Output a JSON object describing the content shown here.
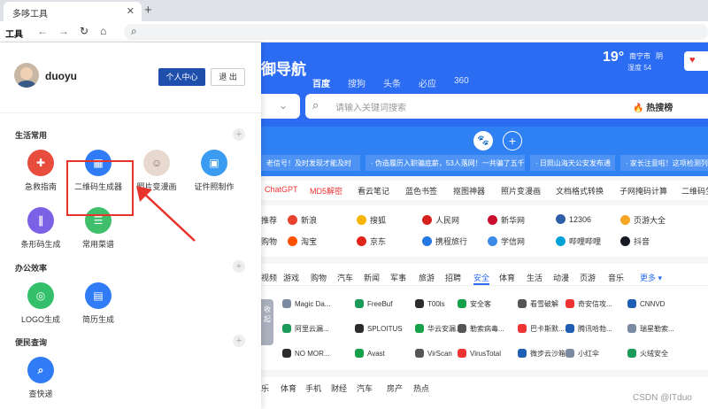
{
  "browser": {
    "tab_title": "多哆工具",
    "close_glyph": "✕",
    "new_tab_glyph": "+",
    "app_label": "工具",
    "back_glyph": "←",
    "forward_glyph": "→",
    "reload_glyph": "↻",
    "home_glyph": "⌂",
    "search_glyph": "⌕"
  },
  "page": {
    "site_title": "御导航",
    "search_tabs": [
      "百度",
      "搜狗",
      "头条",
      "必应",
      "360"
    ],
    "weather": {
      "temp": "19°",
      "city": "南宁市",
      "condition": "阴",
      "humidity": "湿度 54"
    },
    "header_button_glyph": "♥",
    "dropdown_glyph": "⌄",
    "search_placeholder": "请输入关键词搜索",
    "hot_label": "热搜榜",
    "news": [
      "老信号！及时发现才能及时",
      "· 伪造履历入职骗底薪，53人落网！一共骗了五千",
      "· 日照山海天公安发布通",
      "· 家长注意啦！这项检测列入"
    ],
    "tool_links": [
      "ChatGPT",
      "MD5解密",
      "看云笔记",
      "蓝色书签",
      "抠图神器",
      "照片变漫画",
      "文档格式转换",
      "子网掩码计算",
      "二维码生"
    ],
    "sites_row1": [
      "推荐",
      "新浪",
      "搜狐",
      "人民网",
      "新华网",
      "12306",
      "页游大全"
    ],
    "sites_row2": [
      "购物",
      "淘宝",
      "京东",
      "携程旅行",
      "学信网",
      "哔哩哔哩",
      "抖音"
    ],
    "categories": [
      "视频",
      "游戏",
      "购物",
      "汽车",
      "新闻",
      "军事",
      "旅游",
      "招聘",
      "安全",
      "体育",
      "生活",
      "动漫",
      "页游",
      "音乐",
      "更多 ▾"
    ],
    "collapse_label": "收起",
    "sec_row1": [
      "Magic Da...",
      "FreeBuf",
      "T00ls",
      "安全客",
      "看雪破解",
      "奇安信攻...",
      "CNNVD"
    ],
    "sec_row2": [
      "阿里云漏...",
      "SPLOITUS",
      "华云安漏...",
      "勒索病毒...",
      "巴卡斯默...",
      "腾讯哈勃...",
      "瑞星勒索..."
    ],
    "sec_row3": [
      "NO MOR...",
      "Avast",
      "VirScan",
      "VirusTotal",
      "微步云沙箱",
      "小红伞",
      "火绒安全"
    ],
    "bottom_links": [
      "乐",
      "体育",
      "手机",
      "财经",
      "汽车",
      "房产",
      "热点"
    ],
    "watermark": "CSDN @ITduo"
  },
  "panel": {
    "username": "duoyu",
    "center_button": "个人中心",
    "logout_button": "退 出",
    "add_glyph": "+",
    "sections": [
      {
        "title": "生活常用",
        "tools": [
          "急救指南",
          "二维码生成器",
          "照片变漫画",
          "证件照制作",
          "条形码生成",
          "常用菜谱"
        ]
      },
      {
        "title": "办公效率",
        "tools": [
          "LOGO生成",
          "简历生成"
        ]
      },
      {
        "title": "便民查询",
        "tools": [
          "查快递"
        ]
      }
    ]
  },
  "colors": {
    "brand_blue": "#2b6cf3",
    "button_blue": "#1f4fad",
    "highlight_red": "#e8332b"
  }
}
